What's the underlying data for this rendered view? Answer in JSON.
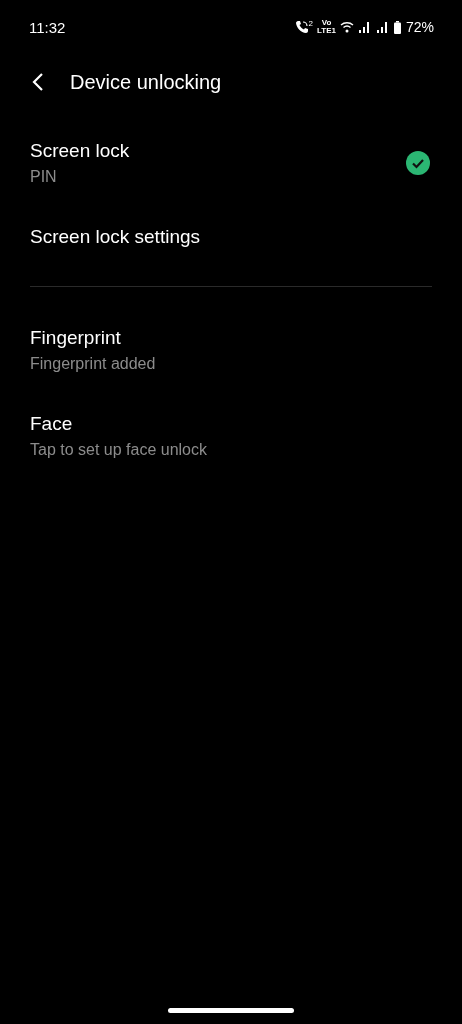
{
  "status_bar": {
    "time": "11:32",
    "call_sim": "2",
    "network_badge_top": "Vo",
    "network_badge_bottom": "LTE1",
    "battery": "72%"
  },
  "header": {
    "title": "Device unlocking"
  },
  "sections": [
    {
      "items": [
        {
          "title": "Screen lock",
          "subtitle": "PIN",
          "checked": true
        },
        {
          "title": "Screen lock settings",
          "checked": false
        }
      ]
    },
    {
      "items": [
        {
          "title": "Fingerprint",
          "subtitle": "Fingerprint added",
          "checked": false
        },
        {
          "title": "Face",
          "subtitle": "Tap to set up face unlock",
          "checked": false
        }
      ]
    }
  ]
}
